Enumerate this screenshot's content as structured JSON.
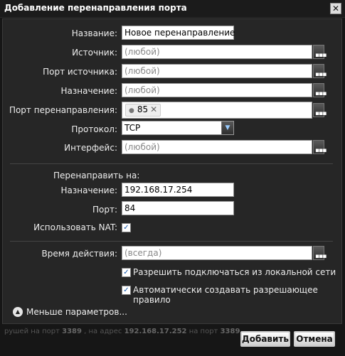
{
  "dialog": {
    "title": "Добавление перенаправления порта"
  },
  "form": {
    "name_label": "Название:",
    "name_value": "Новое перенаправление",
    "source_label": "Источник:",
    "source_placeholder": "(любой)",
    "source_port_label": "Порт источника:",
    "source_port_placeholder": "(любой)",
    "dest_label": "Назначение:",
    "dest_placeholder": "(любой)",
    "redirect_port_label": "Порт перенаправления:",
    "redirect_port_tag": "85",
    "protocol_label": "Протокол:",
    "protocol_value": "TCP",
    "interface_label": "Интерфейс:",
    "interface_placeholder": "(любой)"
  },
  "redirect": {
    "section_label": "Перенаправить на:",
    "dest_label": "Назначение:",
    "dest_value": "192.168.17.254",
    "port_label": "Порт:",
    "port_value": "84",
    "nat_label": "Использовать NAT:",
    "nat_checked": true
  },
  "schedule": {
    "time_label": "Время действия:",
    "time_placeholder": "(всегда)",
    "allow_local_label": "Разрешить подключаться из локальной сети",
    "allow_local_checked": true,
    "auto_rule_label": "Автоматически создавать разрешающее правило",
    "auto_rule_checked": true
  },
  "less_params_label": "Меньше параметров...",
  "footer": {
    "pre": "рушей на порт",
    "port": "3389",
    "mid": ", на адрес",
    "addr": "192.168.17.252",
    "mid2": "на порт",
    "port2": "3389"
  },
  "buttons": {
    "add": "Добавить",
    "cancel": "Отмена"
  },
  "icons": {
    "close": "close-icon",
    "browse": "ellipsis-icon",
    "dropdown": "chevron-down-icon",
    "collapse": "collapse-up-icon"
  }
}
